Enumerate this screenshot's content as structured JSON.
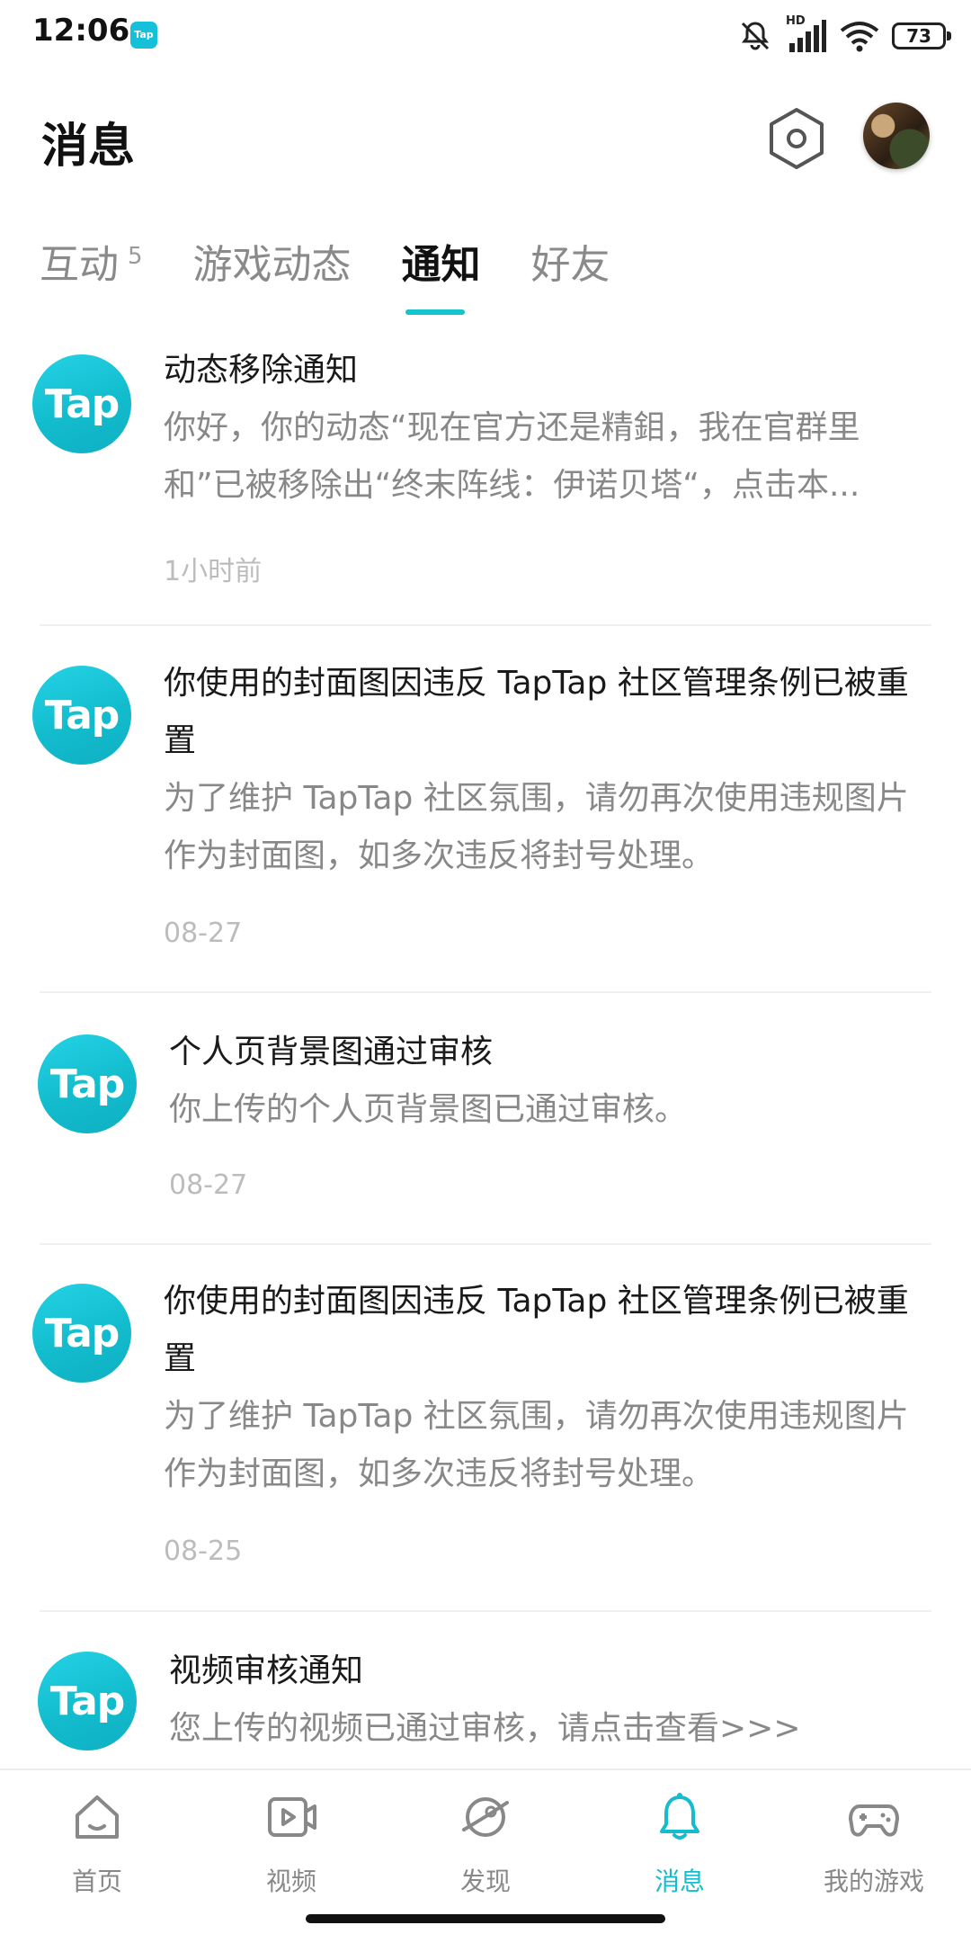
{
  "status_bar": {
    "time": "12:06",
    "app_icon_text": "Tap",
    "battery": "73",
    "network_label": "HD"
  },
  "header": {
    "title": "消息"
  },
  "tabs": [
    {
      "label": "互动",
      "count": "5"
    },
    {
      "label": "游戏动态"
    },
    {
      "label": "通知",
      "active": true
    },
    {
      "label": "好友"
    }
  ],
  "avatar_logo_text": "Tap",
  "notifications": [
    {
      "title": "动态移除通知",
      "body": "你好，你的动态“现在官方还是精鉬，我在官群里和”已被移除出“终末阵线：伊诺贝塔“，点击本...",
      "time": "1小时前"
    },
    {
      "title": "你使用的封面图因违反 TapTap 社区管理条例已被重置",
      "body": "为了维护 TapTap 社区氛围，请勿再次使用违规图片作为封面图，如多次违反将封号处理。",
      "time": "08-27"
    },
    {
      "title": "个人页背景图通过审核",
      "body": "你上传的个人页背景图已通过审核。",
      "time": "08-27"
    },
    {
      "title": "你使用的封面图因违反 TapTap 社区管理条例已被重置",
      "body": "为了维护 TapTap 社区氛围，请勿再次使用违规图片作为封面图，如多次违反将封号处理。",
      "time": "08-25"
    },
    {
      "title": "视频审核通知",
      "body": "您上传的视频已通过审核，请点击查看>>>"
    }
  ],
  "bottom_nav": [
    {
      "label": "首页",
      "icon": "home-icon"
    },
    {
      "label": "视频",
      "icon": "video-icon"
    },
    {
      "label": "发现",
      "icon": "planet-icon"
    },
    {
      "label": "消息",
      "icon": "bell-icon",
      "active": true
    },
    {
      "label": "我的游戏",
      "icon": "gamepad-icon"
    }
  ],
  "colors": {
    "accent": "#15c5ce",
    "muted": "#888888",
    "time": "#bcbcbc"
  }
}
